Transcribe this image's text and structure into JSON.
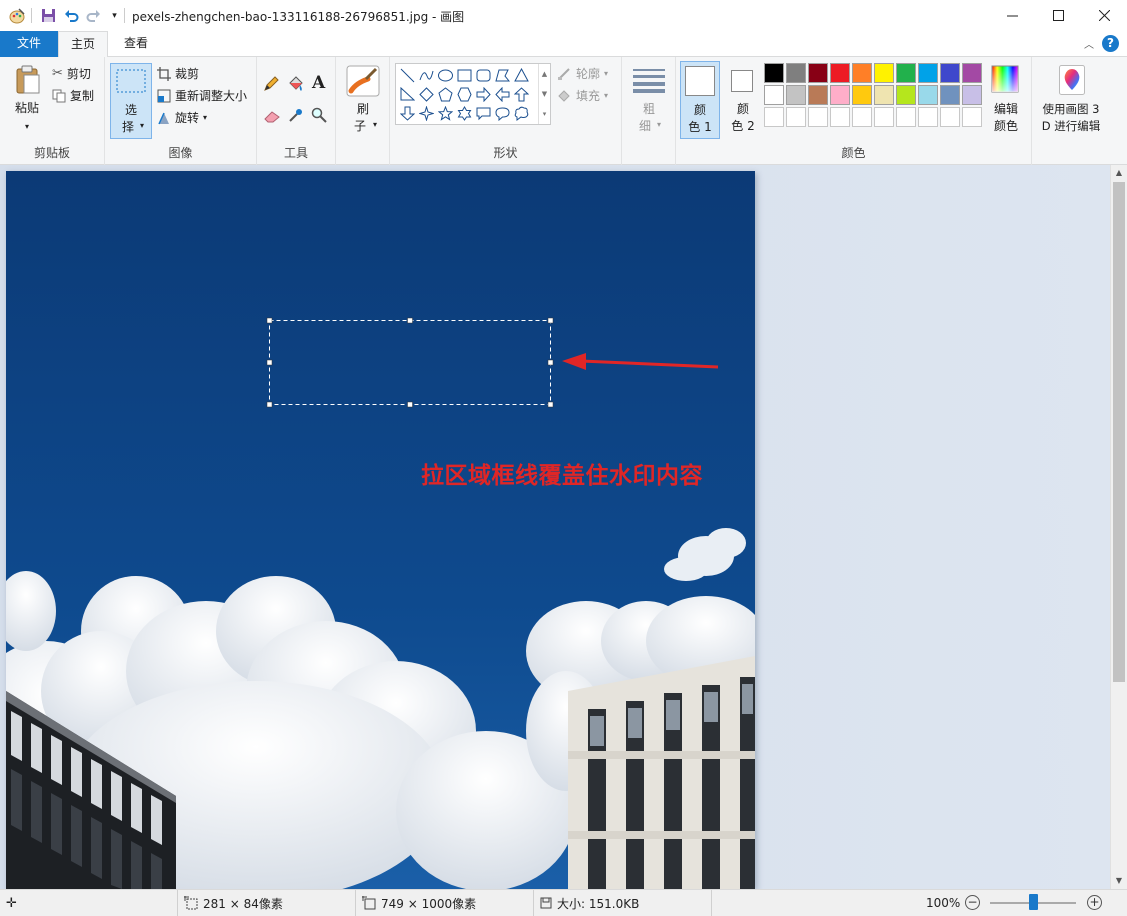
{
  "window": {
    "title": "pexels-zhengchen-bao-133116188-26796851.jpg - 画图",
    "minimize_icon": "minimize-icon",
    "maximize_icon": "maximize-icon",
    "close_icon": "close-icon"
  },
  "quick_access": {
    "items": [
      "paint-app-icon",
      "save-icon",
      "undo-icon",
      "redo-icon",
      "customize-dropdown-icon"
    ]
  },
  "tabs": {
    "file": "文件",
    "home": "主页",
    "view": "查看",
    "help_label": "?"
  },
  "clipboard": {
    "paste": "粘贴",
    "cut": "剪切",
    "copy": "复制",
    "group": "剪贴板"
  },
  "image": {
    "select_line1": "选",
    "select_line2": "择",
    "crop": "裁剪",
    "resize": "重新调整大小",
    "rotate": "旋转",
    "group": "图像"
  },
  "tools": {
    "group": "工具",
    "text_glyph": "A"
  },
  "brushes": {
    "line1": "刷",
    "line2": "子"
  },
  "shapes": {
    "outline": "轮廓",
    "fill": "填充",
    "group": "形状"
  },
  "size": {
    "line1": "粗",
    "line2": "细"
  },
  "colors": {
    "color1_line1": "颜",
    "color1_line2": "色 1",
    "color2_line1": "颜",
    "color2_line2": "色 2",
    "edit_line1": "编辑",
    "edit_line2": "颜色",
    "group": "颜色",
    "palette_row1": [
      "#000000",
      "#7f7f7f",
      "#880015",
      "#ed1c24",
      "#ff7f27",
      "#fff200",
      "#22b14c",
      "#00a2e8",
      "#3f48cc",
      "#a349a4"
    ],
    "palette_row2": [
      "#ffffff",
      "#c3c3c3",
      "#b97a57",
      "#ffaec9",
      "#ffc90e",
      "#efe4b0",
      "#b5e61d",
      "#99d9ea",
      "#7092be",
      "#c8bfe7"
    ],
    "color1_value": "#ffffff",
    "color2_value": "#ffffff",
    "accent": "#1979ca"
  },
  "paint3d": {
    "line1": "使用画图 3",
    "line2": "D 进行编辑"
  },
  "canvas": {
    "annotation": "拉区域框线覆盖住水印内容",
    "annotation_color": "#e02626",
    "sky_color": "#0d3f7c"
  },
  "status": {
    "selection_size": "281 × 84像素",
    "image_size": "749 × 1000像素",
    "file_size": "大小: 151.0KB",
    "zoom": "100%"
  }
}
